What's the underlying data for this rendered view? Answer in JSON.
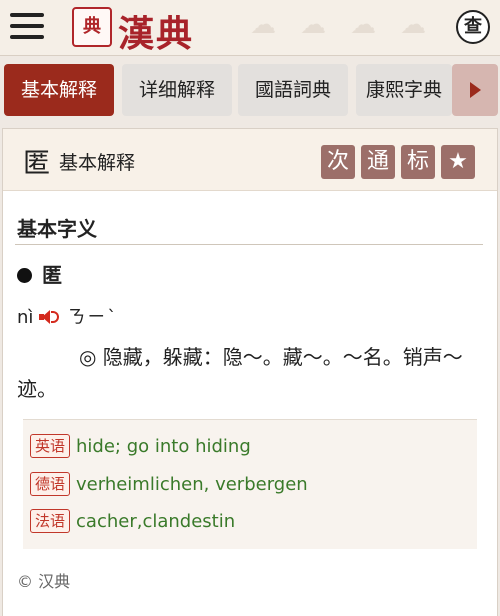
{
  "header": {
    "logo_seal": "典",
    "logo_text": "漢典",
    "search_label": "查"
  },
  "tabs": [
    {
      "label": "基本解释",
      "active": true
    },
    {
      "label": "详细解释",
      "active": false
    },
    {
      "label": "國語詞典",
      "active": false
    },
    {
      "label": "康熙字典",
      "active": false
    }
  ],
  "card": {
    "character": "匿",
    "title": "基本解释",
    "buttons": [
      "次",
      "通",
      "标"
    ],
    "star": "★",
    "section_title": "基本字义",
    "entry_char": "匿",
    "pinyin": "nì",
    "bopomofo": "ㄋㄧˋ",
    "definition": "◎ 隐藏，躲藏：隐～。藏～。～名。销声～迹。"
  },
  "translations": [
    {
      "lang": "英语",
      "text": "hide; go into hiding"
    },
    {
      "lang": "德语",
      "text": "verheimlichen, verbergen"
    },
    {
      "lang": "法语",
      "text": "cacher,clandestin"
    }
  ],
  "footer": {
    "text": "© 汉典"
  }
}
